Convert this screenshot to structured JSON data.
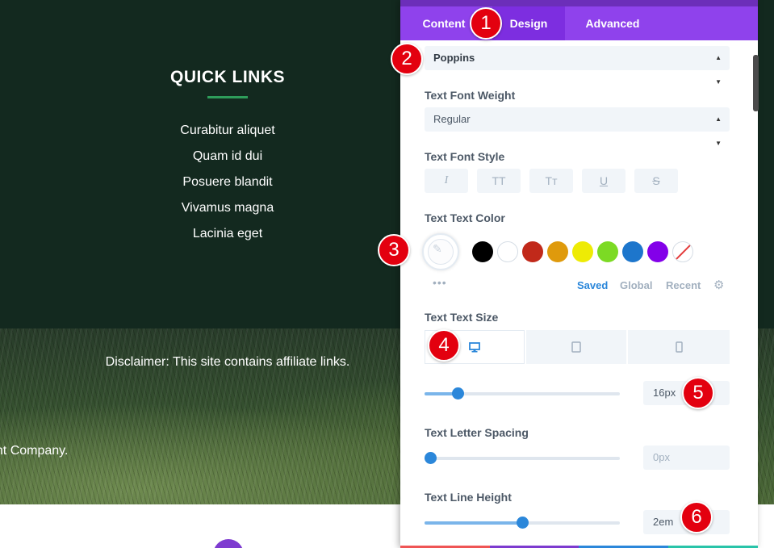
{
  "site": {
    "quick_links_title": "QUICK LINKS",
    "quick_links": [
      "Curabitur aliquet",
      "Quam id dui",
      "Posuere blandit",
      "Vivamus magna",
      "Lacinia eget"
    ],
    "disclaimer": "Disclaimer: This site contains affiliate links.",
    "copyright": "ght Company."
  },
  "panel": {
    "tabs": [
      {
        "label": "Content",
        "active": false
      },
      {
        "label": "Design",
        "active": true
      },
      {
        "label": "Advanced",
        "active": false
      }
    ],
    "font_family_value": "Poppins",
    "font_weight": {
      "label": "Text Font Weight",
      "value": "Regular"
    },
    "font_style": {
      "label": "Text Font Style",
      "buttons": [
        {
          "icon": "italic-icon",
          "glyph": "I"
        },
        {
          "icon": "uppercase-icon",
          "glyph": "TT"
        },
        {
          "icon": "capitalize-icon",
          "glyph": "Tт"
        },
        {
          "icon": "underline-icon",
          "glyph": "U"
        },
        {
          "icon": "strikethrough-icon",
          "glyph": "S"
        }
      ]
    },
    "text_color": {
      "label": "Text Text Color",
      "swatches": [
        "#000000",
        "#ffffff",
        "#c1291a",
        "#df9a0c",
        "#eeeb05",
        "#7cda24",
        "#1d76cc",
        "#8300e9"
      ],
      "palette_tabs": [
        {
          "label": "Saved",
          "active": true
        },
        {
          "label": "Global",
          "active": false
        },
        {
          "label": "Recent",
          "active": false
        }
      ]
    },
    "text_size": {
      "label": "Text Text Size",
      "value": "16px",
      "slider_fraction": 0.17
    },
    "letter_spacing": {
      "label": "Text Letter Spacing",
      "value": "0px",
      "slider_fraction": 0.03
    },
    "line_height": {
      "label": "Text Line Height",
      "value": "2em",
      "slider_fraction": 0.5
    }
  },
  "badges": [
    "1",
    "2",
    "3",
    "4",
    "5",
    "6"
  ],
  "colors": {
    "accent_purple": "#8f42ec",
    "active_tab": "#7d2ee0",
    "slider_blue": "#2b87da",
    "footer_dark": "#13291f",
    "badge_red": "#e3000f"
  }
}
